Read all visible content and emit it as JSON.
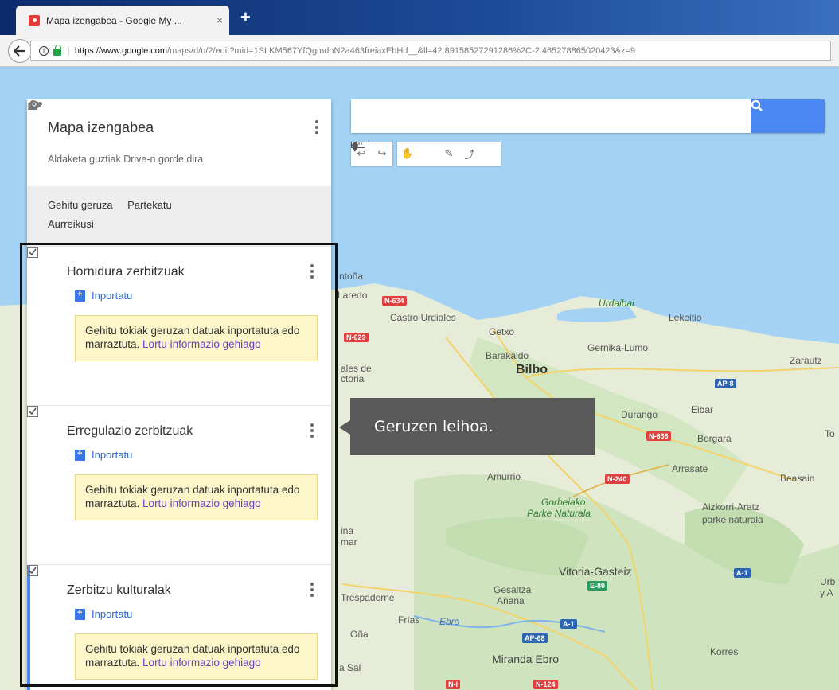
{
  "browser": {
    "tab_title": "Mapa izengabea - Google My ...",
    "tab_close": "×",
    "new_tab": "+",
    "url_domain": "https://www.google.com",
    "url_path": "/maps/d/u/2/edit?mid=1SLKM567YfQgmdnN2a463freiaxEhHd__&ll=42.89158527291286%2C-2.465278865020423&z=9",
    "back_glyph": "🡐",
    "info_glyph": "i"
  },
  "search": {
    "placeholder": ""
  },
  "toolbar": {
    "icons": [
      "undo-icon",
      "redo-icon",
      "hand-icon",
      "marker-icon",
      "draw-line-icon",
      "directions-icon",
      "ruler-icon"
    ],
    "undo": "↩",
    "redo": "↪",
    "hand": "✋",
    "marker": "📍",
    "line": "✎",
    "route": "⤴",
    "ruler": "▭"
  },
  "panel": {
    "title": "Mapa izengabea",
    "save_status": "Aldaketa guztiak Drive-n gorde dira",
    "add_layer": "Gehitu geruza",
    "share": "Partekatu",
    "preview": "Aurreikusi",
    "layers": [
      {
        "name": "Hornidura zerbitzuak",
        "import": "Inportatu",
        "hint": "Gehitu tokiak geruzan datuak inportatuta edo marraztuta.",
        "hint_link": "Lortu informazio gehiago"
      },
      {
        "name": "Erregulazio zerbitzuak",
        "import": "Inportatu",
        "hint": "Gehitu tokiak geruzan datuak inportatuta edo marraztuta.",
        "hint_link": "Lortu informazio gehiago"
      },
      {
        "name": "Zerbitzu kulturalak",
        "import": "Inportatu",
        "hint": "Gehitu tokiak geruzan datuak inportatuta edo marraztuta.",
        "hint_link": "Lortu informazio gehiago"
      }
    ]
  },
  "callout": {
    "text": "Geruzen leihoa."
  },
  "map": {
    "places": {
      "bilbo": "Bilbo",
      "getxo": "Getxo",
      "barakaldo": "Barakaldo",
      "castro": "Castro Urdiales",
      "laredo": "Laredo",
      "santona": "ntoña",
      "urdaibai": "Urdaibai",
      "lekeitio": "Lekeitio",
      "gernika": "Gernika-Lumo",
      "zarautz": "Zarautz",
      "durango": "Durango",
      "eibar": "Eibar",
      "bergara": "Bergara",
      "to": "To",
      "arrasate": "Arrasate",
      "beasain": "Beasain",
      "amurrio": "Amurrio",
      "gorbeia1": "Gorbeiako",
      "gorbeia2": "Parke Naturala",
      "aizkorri1": "Aizkorri-Aratz",
      "aizkorri2": "parke naturala",
      "vitoria": "Vitoria-Gasteiz",
      "urb1": "Urb",
      "urb2": "y A",
      "gesaltza1": "Gesaltza",
      "gesaltza2": "Añana",
      "espaderne": "Trespaderne",
      "frias": "Frías",
      "ebro": "Ebro",
      "ona": "Oña",
      "miranda": "Miranda Ebro",
      "korres": "Korres",
      "sal": "a Sal",
      "valles1": "ales de",
      "valles2": "ctoria",
      "ina1": "ina",
      "ina2": "mar"
    },
    "shields": {
      "n634": "N-634",
      "n629": "N-629",
      "ap8": "AP-8",
      "n636": "N-636",
      "n240": "N-240",
      "a1a": "A-1",
      "e80": "E-80",
      "a1b": "A-1",
      "ap68": "AP-68",
      "n1": "N-I",
      "n124": "N-124"
    }
  }
}
